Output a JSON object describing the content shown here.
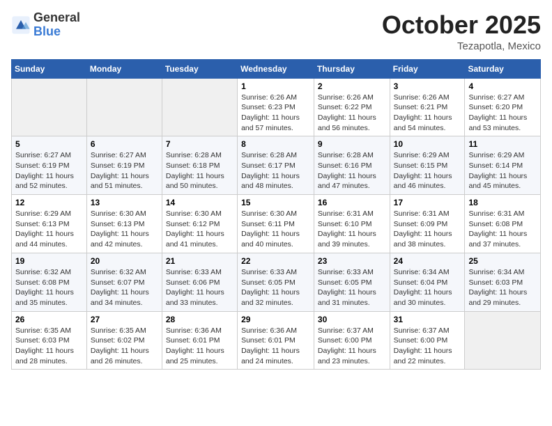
{
  "header": {
    "logo_line1": "General",
    "logo_line2": "Blue",
    "month": "October 2025",
    "location": "Tezapotla, Mexico"
  },
  "weekdays": [
    "Sunday",
    "Monday",
    "Tuesday",
    "Wednesday",
    "Thursday",
    "Friday",
    "Saturday"
  ],
  "weeks": [
    [
      {
        "day": "",
        "info": ""
      },
      {
        "day": "",
        "info": ""
      },
      {
        "day": "",
        "info": ""
      },
      {
        "day": "1",
        "info": "Sunrise: 6:26 AM\nSunset: 6:23 PM\nDaylight: 11 hours and 57 minutes."
      },
      {
        "day": "2",
        "info": "Sunrise: 6:26 AM\nSunset: 6:22 PM\nDaylight: 11 hours and 56 minutes."
      },
      {
        "day": "3",
        "info": "Sunrise: 6:26 AM\nSunset: 6:21 PM\nDaylight: 11 hours and 54 minutes."
      },
      {
        "day": "4",
        "info": "Sunrise: 6:27 AM\nSunset: 6:20 PM\nDaylight: 11 hours and 53 minutes."
      }
    ],
    [
      {
        "day": "5",
        "info": "Sunrise: 6:27 AM\nSunset: 6:19 PM\nDaylight: 11 hours and 52 minutes."
      },
      {
        "day": "6",
        "info": "Sunrise: 6:27 AM\nSunset: 6:19 PM\nDaylight: 11 hours and 51 minutes."
      },
      {
        "day": "7",
        "info": "Sunrise: 6:28 AM\nSunset: 6:18 PM\nDaylight: 11 hours and 50 minutes."
      },
      {
        "day": "8",
        "info": "Sunrise: 6:28 AM\nSunset: 6:17 PM\nDaylight: 11 hours and 48 minutes."
      },
      {
        "day": "9",
        "info": "Sunrise: 6:28 AM\nSunset: 6:16 PM\nDaylight: 11 hours and 47 minutes."
      },
      {
        "day": "10",
        "info": "Sunrise: 6:29 AM\nSunset: 6:15 PM\nDaylight: 11 hours and 46 minutes."
      },
      {
        "day": "11",
        "info": "Sunrise: 6:29 AM\nSunset: 6:14 PM\nDaylight: 11 hours and 45 minutes."
      }
    ],
    [
      {
        "day": "12",
        "info": "Sunrise: 6:29 AM\nSunset: 6:13 PM\nDaylight: 11 hours and 44 minutes."
      },
      {
        "day": "13",
        "info": "Sunrise: 6:30 AM\nSunset: 6:13 PM\nDaylight: 11 hours and 42 minutes."
      },
      {
        "day": "14",
        "info": "Sunrise: 6:30 AM\nSunset: 6:12 PM\nDaylight: 11 hours and 41 minutes."
      },
      {
        "day": "15",
        "info": "Sunrise: 6:30 AM\nSunset: 6:11 PM\nDaylight: 11 hours and 40 minutes."
      },
      {
        "day": "16",
        "info": "Sunrise: 6:31 AM\nSunset: 6:10 PM\nDaylight: 11 hours and 39 minutes."
      },
      {
        "day": "17",
        "info": "Sunrise: 6:31 AM\nSunset: 6:09 PM\nDaylight: 11 hours and 38 minutes."
      },
      {
        "day": "18",
        "info": "Sunrise: 6:31 AM\nSunset: 6:08 PM\nDaylight: 11 hours and 37 minutes."
      }
    ],
    [
      {
        "day": "19",
        "info": "Sunrise: 6:32 AM\nSunset: 6:08 PM\nDaylight: 11 hours and 35 minutes."
      },
      {
        "day": "20",
        "info": "Sunrise: 6:32 AM\nSunset: 6:07 PM\nDaylight: 11 hours and 34 minutes."
      },
      {
        "day": "21",
        "info": "Sunrise: 6:33 AM\nSunset: 6:06 PM\nDaylight: 11 hours and 33 minutes."
      },
      {
        "day": "22",
        "info": "Sunrise: 6:33 AM\nSunset: 6:05 PM\nDaylight: 11 hours and 32 minutes."
      },
      {
        "day": "23",
        "info": "Sunrise: 6:33 AM\nSunset: 6:05 PM\nDaylight: 11 hours and 31 minutes."
      },
      {
        "day": "24",
        "info": "Sunrise: 6:34 AM\nSunset: 6:04 PM\nDaylight: 11 hours and 30 minutes."
      },
      {
        "day": "25",
        "info": "Sunrise: 6:34 AM\nSunset: 6:03 PM\nDaylight: 11 hours and 29 minutes."
      }
    ],
    [
      {
        "day": "26",
        "info": "Sunrise: 6:35 AM\nSunset: 6:03 PM\nDaylight: 11 hours and 28 minutes."
      },
      {
        "day": "27",
        "info": "Sunrise: 6:35 AM\nSunset: 6:02 PM\nDaylight: 11 hours and 26 minutes."
      },
      {
        "day": "28",
        "info": "Sunrise: 6:36 AM\nSunset: 6:01 PM\nDaylight: 11 hours and 25 minutes."
      },
      {
        "day": "29",
        "info": "Sunrise: 6:36 AM\nSunset: 6:01 PM\nDaylight: 11 hours and 24 minutes."
      },
      {
        "day": "30",
        "info": "Sunrise: 6:37 AM\nSunset: 6:00 PM\nDaylight: 11 hours and 23 minutes."
      },
      {
        "day": "31",
        "info": "Sunrise: 6:37 AM\nSunset: 6:00 PM\nDaylight: 11 hours and 22 minutes."
      },
      {
        "day": "",
        "info": ""
      }
    ]
  ]
}
